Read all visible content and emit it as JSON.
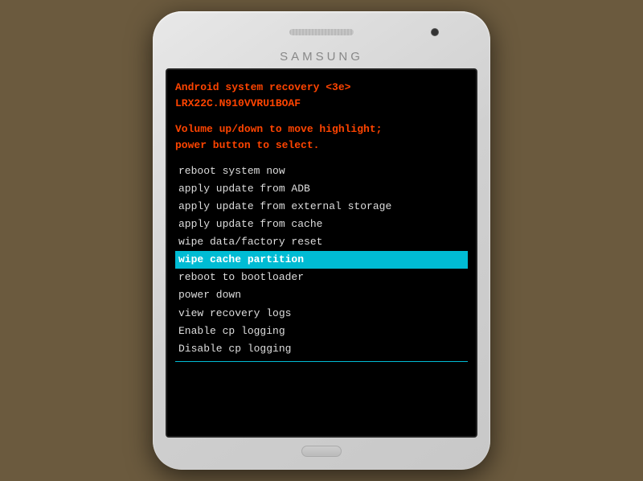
{
  "phone": {
    "brand": "SAMSUNG",
    "speaker_label": "speaker",
    "camera_label": "front-camera"
  },
  "recovery": {
    "header": {
      "line1": "Android system recovery <3e>",
      "line2": "LRX22C.N910VVRU1BOAF"
    },
    "instructions": {
      "line1": "Volume up/down to move highlight;",
      "line2": "power button to select."
    },
    "menu_items": [
      {
        "id": "reboot-system",
        "label": "reboot system now",
        "selected": false
      },
      {
        "id": "apply-adb",
        "label": "apply update from ADB",
        "selected": false
      },
      {
        "id": "apply-external",
        "label": "apply update from external storage",
        "selected": false
      },
      {
        "id": "apply-cache",
        "label": "apply update from cache",
        "selected": false
      },
      {
        "id": "wipe-data",
        "label": "wipe data/factory reset",
        "selected": false
      },
      {
        "id": "wipe-cache",
        "label": "wipe cache partition",
        "selected": true
      },
      {
        "id": "reboot-bootloader",
        "label": "reboot to bootloader",
        "selected": false
      },
      {
        "id": "power-down",
        "label": "power down",
        "selected": false
      },
      {
        "id": "view-recovery-logs",
        "label": "view recovery logs",
        "selected": false
      },
      {
        "id": "enable-cp-logging",
        "label": "Enable cp logging",
        "selected": false
      },
      {
        "id": "disable-cp-logging",
        "label": "Disable cp logging",
        "selected": false
      }
    ]
  }
}
